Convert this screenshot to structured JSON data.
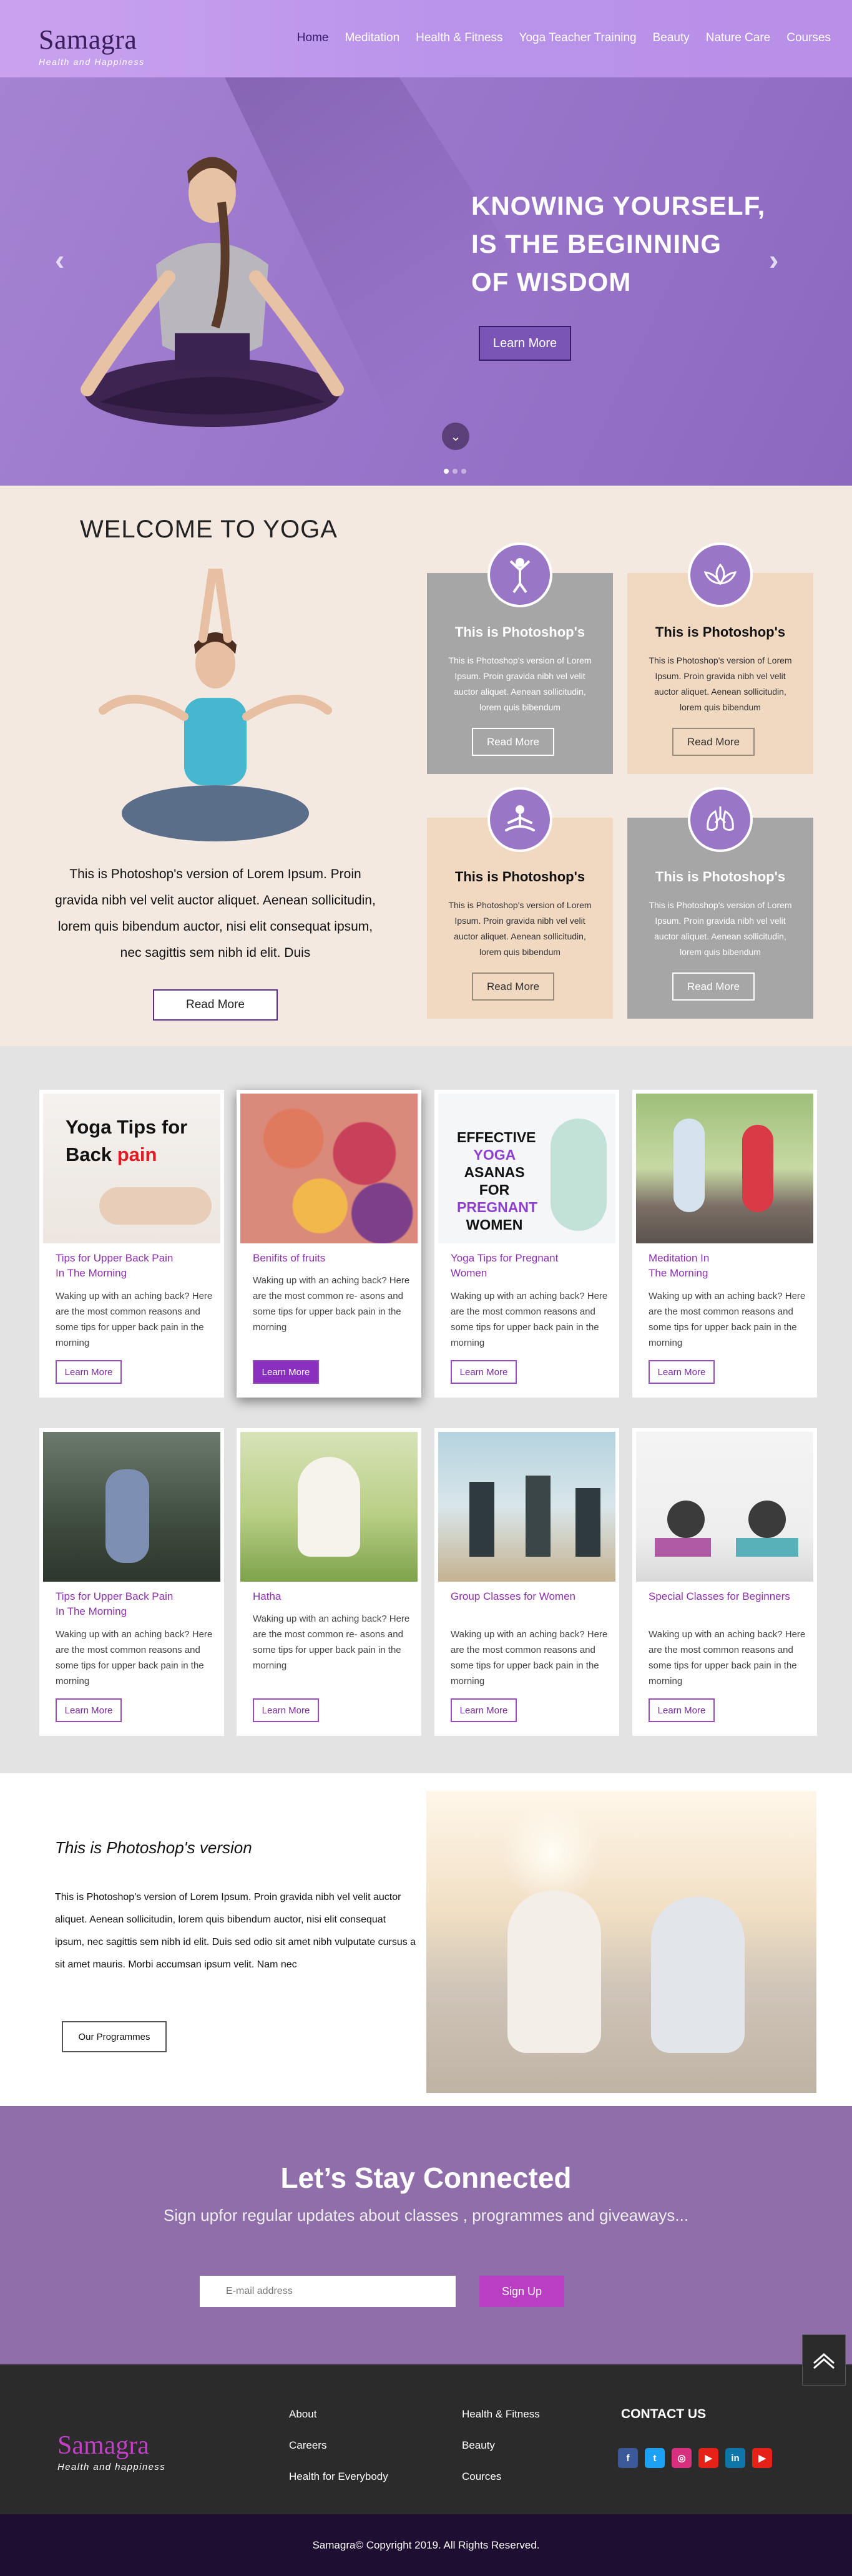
{
  "header": {
    "brand": "Samagra",
    "tagline": "Health and Happiness",
    "nav": [
      "Home",
      "Meditation",
      "Health & Fitness",
      "Yoga Teacher Training",
      "Beauty",
      "Nature Care",
      "Courses"
    ]
  },
  "hero": {
    "headline_1": "KNOWING YOURSELF,",
    "headline_2": "IS THE BEGINNING",
    "headline_3": "OF WISDOM",
    "button": "Learn More",
    "prev": "‹",
    "next": "›",
    "down_icon": "⌄",
    "slide_count": 3,
    "active_slide": 1
  },
  "welcome": {
    "title": "WELCOME TO YOGA",
    "text": "This is Photoshop's version  of Lorem Ipsum. Proin gravida nibh vel velit auctor aliquet. Aenean sollicitudin, lorem quis bibendum auctor, nisi elit consequat ipsum, nec sagittis sem nibh id elit. Duis",
    "button": "Read More",
    "cards": [
      {
        "title": "This is Photoshop's",
        "text": "This is Photoshop's version  of Lorem Ipsum. Proin gravida nibh vel velit auctor aliquet. Aenean sollicitudin, lorem quis bibendum",
        "button": "Read More",
        "icon": "yoga-pose-icon"
      },
      {
        "title": "This is Photoshop's",
        "text": "This is Photoshop's version  of Lorem Ipsum. Proin gravida nibh vel velit auctor aliquet. Aenean sollicitudin, lorem quis bibendum",
        "button": "Read More",
        "icon": "lotus-icon"
      },
      {
        "title": "This is Photoshop's",
        "text": "This is Photoshop's version  of Lorem Ipsum. Proin gravida nibh vel velit auctor aliquet. Aenean sollicitudin, lorem quis bibendum",
        "button": "Read More",
        "icon": "meditation-icon"
      },
      {
        "title": "This is Photoshop's",
        "text": "This is Photoshop's version  of Lorem Ipsum. Proin gravida nibh vel velit auctor aliquet. Aenean sollicitudin, lorem quis bibendum",
        "button": "Read More",
        "icon": "lungs-icon"
      }
    ]
  },
  "posts": [
    {
      "title_1": "Tips for Upper Back Pain",
      "title_2": "In The Morning",
      "text": "Waking up with an aching back? Here are the most common reasons and some tips for upper back pain in the morning",
      "button": "Learn More",
      "img_text_1": "Yoga Tips for",
      "img_text_2": "Back ",
      "img_text_3": "pain"
    },
    {
      "title_1": "Benifits of fruits",
      "title_2": "",
      "text": "Waking up with an aching back? Here are the most common re- asons and some tips for upper back pain in the morning",
      "button": "Learn More"
    },
    {
      "title_1": "Yoga Tips for Pregnant",
      "title_2": "Women",
      "text": "Waking up with an aching back? Here are the most common reasons and some tips for upper back pain in the morning",
      "button": "Learn More",
      "img_text_1": "EFFECTIVE",
      "img_text_2": "YOGA",
      "img_text_3": "ASANAS",
      "img_text_4": "FOR",
      "img_text_5": "PREGNANT",
      "img_text_6": "WOMEN"
    },
    {
      "title_1": "Meditation In",
      "title_2": "The Morning",
      "text": "Waking up with an aching back? Here are the most common reasons and some tips for upper back pain in the morning",
      "button": "Learn More"
    },
    {
      "title_1": "Tips for Upper Back Pain",
      "title_2": "In The Morning",
      "text": "Waking up with an aching back? Here are the most common reasons and some tips for upper back pain in the morning",
      "button": "Learn More"
    },
    {
      "title_1": "Hatha",
      "title_2": "",
      "text": "Waking up with an aching back? Here are the most common re- asons and some tips for upper back pain in the morning",
      "button": "Learn More"
    },
    {
      "title_1": "Group Classes for Women",
      "title_2": "",
      "text": "Waking up with an aching back? Here are the most common reasons and some tips for upper back pain in the morning",
      "button": "Learn More"
    },
    {
      "title_1": "Special Classes for Beginners",
      "title_2": "",
      "text": "Waking up with an aching back? Here are the most common reasons and some tips for upper back pain in the morning",
      "button": "Learn More"
    }
  ],
  "photoshop": {
    "title": "This is Photoshop's version",
    "text": "This is Photoshop's version  of Lorem Ipsum. Proin gravida nibh vel velit auctor aliquet. Aenean sollicitudin, lorem quis bibendum auctor, nisi elit consequat ipsum, nec sagittis sem nibh id elit. Duis sed odio sit amet nibh vulputate cursus a sit amet mauris. Morbi accumsan ipsum velit. Nam nec",
    "button": "Our Programmes"
  },
  "connect": {
    "title": "Let’s Stay Connected",
    "subtitle": "Sign upfor regular updates about classes , programmes and giveaways...",
    "placeholder": "E-mail address",
    "button": "Sign Up"
  },
  "footer": {
    "brand": "Samagra",
    "tagline": "Health and happiness",
    "col1": [
      "About",
      "Careers",
      "Health for Everybody"
    ],
    "col2": [
      "Health & Fitness",
      "Beauty",
      "Cources"
    ],
    "contact_title": "CONTACT US",
    "social": [
      {
        "icon": "facebook-icon",
        "glyph": "f",
        "color": "#3b5998"
      },
      {
        "icon": "twitter-icon",
        "glyph": "t",
        "color": "#1da1f2"
      },
      {
        "icon": "instagram-icon",
        "glyph": "◎",
        "color": "#d6307e"
      },
      {
        "icon": "youtube-icon",
        "glyph": "▶",
        "color": "#e62117"
      },
      {
        "icon": "linkedin-icon",
        "glyph": "in",
        "color": "#0e76a8"
      },
      {
        "icon": "youtube-icon",
        "glyph": "▶",
        "color": "#e62117"
      }
    ],
    "copyright": "Samagra© Copyright 2019. All Rights Reserved."
  },
  "colors": {
    "accent": "#9a76c7",
    "brand_dark": "#3a1d5a",
    "link": "#8e2fb0"
  }
}
